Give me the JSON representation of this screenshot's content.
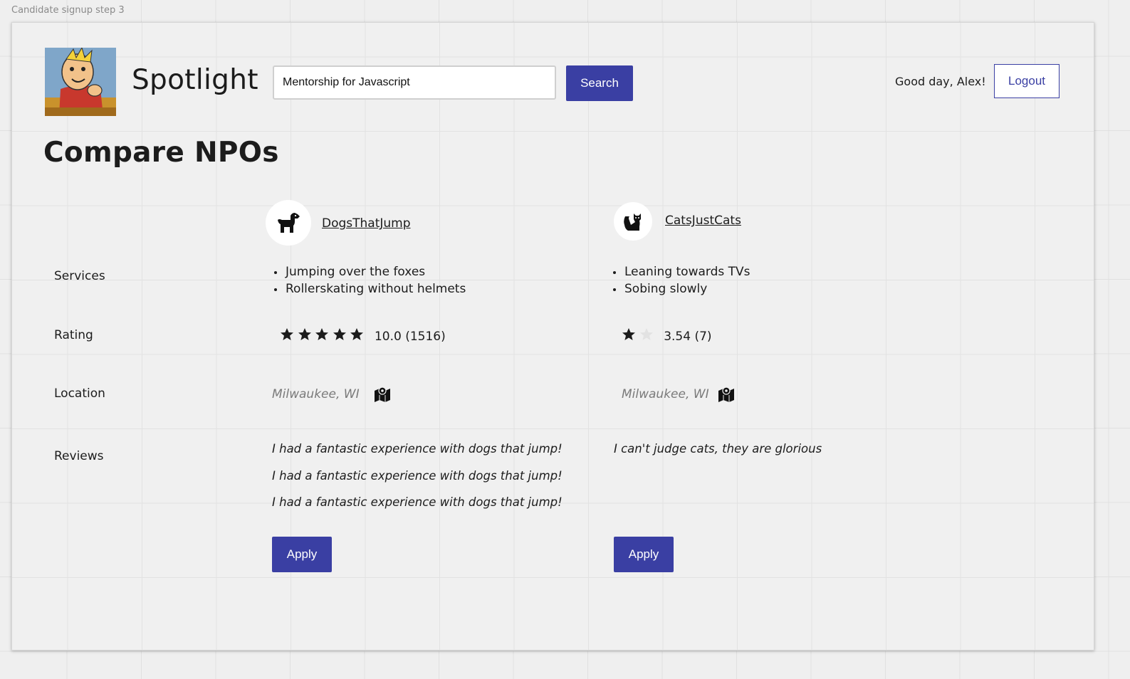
{
  "board": {
    "label": "Candidate signup step 3"
  },
  "header": {
    "brand": "Spotlight",
    "search": {
      "value": "Mentorship for Javascript",
      "placeholder": ""
    },
    "search_label": "Search",
    "greeting": "Good day, Alex!",
    "logout_label": "Logout"
  },
  "page": {
    "title": "Compare NPOs"
  },
  "rows": {
    "services": "Services",
    "rating": "Rating",
    "location": "Location",
    "reviews": "Reviews"
  },
  "npos": [
    {
      "name": "DogsThatJump",
      "icon": "dog-icon",
      "services": [
        "Jumping over the foxes",
        "Rollerskating without helmets"
      ],
      "rating": {
        "stars_filled": 5,
        "stars_shown": 5,
        "text": "10.0 (1516)"
      },
      "location": "Milwaukee, WI",
      "reviews": [
        "I had a fantastic experience with dogs that jump!",
        "I had a fantastic experience with dogs that jump!",
        "I had a fantastic experience with dogs that jump!"
      ],
      "apply_label": "Apply"
    },
    {
      "name": "CatsJustCats",
      "icon": "cat-icon",
      "services": [
        "Leaning towards TVs",
        "Sobing slowly"
      ],
      "rating": {
        "stars_filled": 1,
        "stars_shown": 2,
        "text": "3.54 (7)"
      },
      "location": "Milwaukee, WI",
      "reviews": [
        "I can't judge cats, they are glorious"
      ],
      "apply_label": "Apply"
    }
  ],
  "colors": {
    "accent": "#3a3fa3",
    "text": "#1c1c1c",
    "muted": "#7a7a7a",
    "star_empty": "#e2e2e2"
  }
}
